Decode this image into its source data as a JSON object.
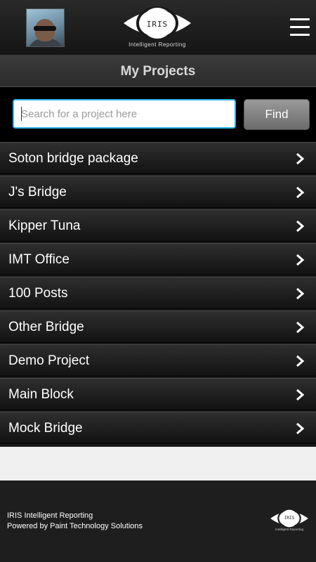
{
  "header": {
    "avatar_icon": "user-avatar",
    "logo_text": "IRIS",
    "logo_subtitle": "Intelligent Reporting",
    "menu_icon": "hamburger-menu-icon"
  },
  "title": "My Projects",
  "search": {
    "placeholder": "Search for a project here",
    "value": "",
    "button_label": "Find"
  },
  "projects": [
    {
      "label": "Soton bridge package"
    },
    {
      "label": "J's Bridge"
    },
    {
      "label": "Kipper Tuna"
    },
    {
      "label": "IMT Office"
    },
    {
      "label": "100 Posts"
    },
    {
      "label": "Other Bridge"
    },
    {
      "label": "Demo Project"
    },
    {
      "label": "Main Block"
    },
    {
      "label": "Mock Bridge"
    }
  ],
  "footer": {
    "line1": "IRIS Intelligent Reporting",
    "line2": "Powered by Paint Technology Solutions",
    "logo_text": "IRIS",
    "logo_subtitle": "Intelligent Reporting"
  },
  "colors": {
    "search_focus": "#33b5e5",
    "background": "#1a1a1a"
  }
}
